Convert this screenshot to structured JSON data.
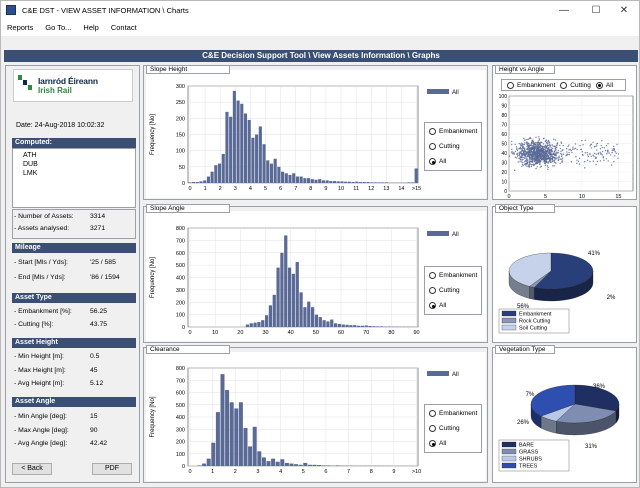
{
  "window": {
    "title": "C&E DST - VIEW ASSET INFORMATION \\ Charts",
    "minimize": "—",
    "maximize": "☐",
    "close": "✕"
  },
  "menu": [
    "Reports",
    "Go To...",
    "Help",
    "Contact"
  ],
  "banner": "C&E Decision Support Tool \\ View Assets Information \\ Graphs",
  "logo": {
    "line1": "Iarnród Éireann",
    "line2": "Irish Rail"
  },
  "date": "Date: 24-Aug-2018 10:02:32",
  "computed": {
    "header": "Computed:",
    "items": [
      "ATH",
      "DUB",
      "LMK"
    ]
  },
  "counts": {
    "assets_label": "- Number of Assets:",
    "assets_value": "3314",
    "analysed_label": "- Assets analysed:",
    "analysed_value": "3271"
  },
  "mileage": {
    "header": "Mileage",
    "start_label": "- Start [Mls / Yds]:",
    "start_value": "'25 / 585",
    "end_label": "- End [Mls / Yds]:",
    "end_value": "'86 / 1594"
  },
  "asset_type": {
    "header": "Asset Type",
    "emb_label": "- Embankment [%]:",
    "emb_value": "56.25",
    "cut_label": "- Cutting [%]:",
    "cut_value": "43.75"
  },
  "asset_height": {
    "header": "Asset Height",
    "min_label": "- Min Height [m]:",
    "min_value": "0.5",
    "max_label": "- Max Height [m]:",
    "max_value": "45",
    "avg_label": "- Avg Height [m]:",
    "avg_value": "5.12"
  },
  "asset_angle": {
    "header": "Asset Angle",
    "min_label": "- Min Angle [deg]:",
    "min_value": "15",
    "max_label": "- Max Angle [deg]:",
    "max_value": "90",
    "avg_label": "- Avg Angle [deg]:",
    "avg_value": "42.42"
  },
  "buttons": {
    "back": "< Back",
    "pdf": "PDF"
  },
  "radios": {
    "embankment": "Embankment",
    "cutting": "Cutting",
    "all": "All"
  },
  "panels": {
    "slope_height": "Slope Height",
    "slope_angle": "Slope Angle",
    "clearance": "Clearance",
    "height_vs_angle": "Height vs Angle",
    "object_type": "Object Type",
    "vegetation_type": "Vegetation Type"
  },
  "colors": {
    "bar": "#5a6a96",
    "navy": "#3b4e73"
  },
  "chart_data": [
    {
      "type": "bar",
      "name": "slope_height",
      "ylabel": "Frequency [No]",
      "legend": [
        "All"
      ],
      "categories": [
        "0",
        "1",
        "2",
        "3",
        "4",
        "5",
        "6",
        "7",
        "8",
        "9",
        "10",
        "11",
        "12",
        "13",
        "14",
        ">15"
      ],
      "ylim": [
        0,
        300
      ],
      "yticks": [
        0,
        50,
        100,
        150,
        200,
        250,
        300
      ],
      "values": [
        2,
        3,
        3,
        5,
        8,
        20,
        35,
        55,
        60,
        90,
        220,
        205,
        285,
        255,
        245,
        215,
        195,
        140,
        150,
        175,
        120,
        70,
        60,
        75,
        50,
        35,
        30,
        25,
        30,
        20,
        20,
        15,
        15,
        12,
        10,
        12,
        8,
        8,
        6,
        6,
        5,
        5,
        4,
        4,
        3,
        4,
        3,
        3,
        3,
        2,
        2,
        2,
        2,
        2,
        1,
        1,
        1,
        1,
        1,
        2,
        2,
        45
      ]
    },
    {
      "type": "bar",
      "name": "slope_angle",
      "ylabel": "Frequency [No]",
      "legend": [
        "All"
      ],
      "categories": [
        "0",
        "10",
        "20",
        "30",
        "40",
        "50",
        "60",
        "70",
        "80",
        "90"
      ],
      "ylim": [
        0,
        800
      ],
      "yticks": [
        0,
        100,
        200,
        300,
        400,
        500,
        600,
        700,
        800
      ],
      "values": [
        1,
        0,
        0,
        0,
        0,
        0,
        0,
        0,
        0,
        0,
        0,
        0,
        0,
        0,
        0,
        20,
        30,
        35,
        40,
        55,
        95,
        175,
        260,
        480,
        600,
        740,
        480,
        430,
        525,
        280,
        160,
        205,
        160,
        100,
        80,
        55,
        45,
        60,
        30,
        25,
        20,
        18,
        15,
        15,
        10,
        10,
        12,
        8,
        6,
        5,
        5,
        3,
        4,
        3,
        3,
        2,
        2,
        2,
        2,
        1
      ]
    },
    {
      "type": "bar",
      "name": "clearance",
      "ylabel": "Frequency [No]",
      "legend": [
        "All"
      ],
      "categories": [
        "0",
        "1",
        "2",
        "3",
        "4",
        "5",
        "6",
        "7",
        "8",
        "9",
        ">10"
      ],
      "ylim": [
        0,
        800
      ],
      "yticks": [
        0,
        100,
        200,
        300,
        400,
        500,
        600,
        700,
        800
      ],
      "values": [
        0,
        0,
        5,
        20,
        60,
        190,
        440,
        750,
        620,
        520,
        470,
        520,
        310,
        160,
        320,
        120,
        70,
        40,
        60,
        35,
        55,
        25,
        20,
        15,
        10,
        25,
        10,
        10,
        8,
        5,
        5,
        3,
        5,
        3,
        3,
        3,
        2,
        2,
        2,
        2,
        2,
        2,
        2,
        2,
        1,
        1,
        1,
        1,
        1,
        1
      ]
    },
    {
      "type": "scatter",
      "name": "height_vs_angle",
      "xlim": [
        0,
        17
      ],
      "ylim": [
        0,
        100
      ],
      "xticks": [
        0,
        5,
        10,
        15
      ],
      "yticks": [
        0,
        10,
        20,
        30,
        40,
        50,
        60,
        70,
        80,
        90,
        100
      ]
    },
    {
      "type": "pie",
      "name": "object_type",
      "labels": [
        "Embankment",
        "Rock Cutting",
        "Soil Cutting"
      ],
      "values": [
        56,
        2,
        41
      ],
      "pct_labels": [
        "56%",
        "2%",
        "41%"
      ],
      "colors": [
        "#283f7a",
        "#8a96b8",
        "#c5d2ea"
      ]
    },
    {
      "type": "pie",
      "name": "vegetation_type",
      "labels": [
        "BARE",
        "GRASS",
        "SHRUBS",
        "TREES"
      ],
      "values": [
        31,
        26,
        7,
        36
      ],
      "pct_labels": [
        "31%",
        "26%",
        "7%",
        "36%"
      ],
      "colors": [
        "#1f2f62",
        "#7f8db3",
        "#b8c8e6",
        "#2f4fb0"
      ]
    }
  ]
}
